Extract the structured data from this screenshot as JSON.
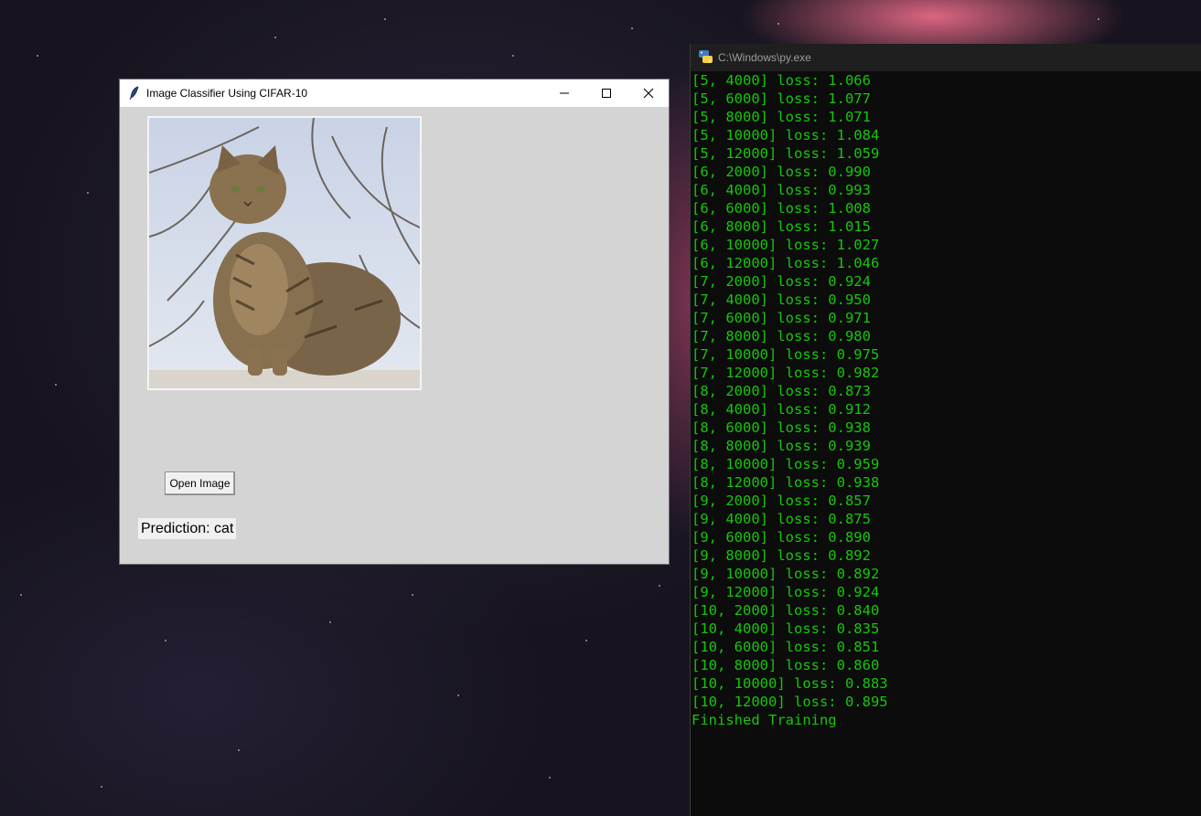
{
  "tk_window": {
    "title": "Image Classifier Using CIFAR-10",
    "open_button_label": "Open Image",
    "prediction_text": "Prediction: cat"
  },
  "console": {
    "title": "C:\\Windows\\py.exe",
    "lines": [
      "[5, 4000] loss: 1.066",
      "[5, 6000] loss: 1.077",
      "[5, 8000] loss: 1.071",
      "[5, 10000] loss: 1.084",
      "[5, 12000] loss: 1.059",
      "[6, 2000] loss: 0.990",
      "[6, 4000] loss: 0.993",
      "[6, 6000] loss: 1.008",
      "[6, 8000] loss: 1.015",
      "[6, 10000] loss: 1.027",
      "[6, 12000] loss: 1.046",
      "[7, 2000] loss: 0.924",
      "[7, 4000] loss: 0.950",
      "[7, 6000] loss: 0.971",
      "[7, 8000] loss: 0.980",
      "[7, 10000] loss: 0.975",
      "[7, 12000] loss: 0.982",
      "[8, 2000] loss: 0.873",
      "[8, 4000] loss: 0.912",
      "[8, 6000] loss: 0.938",
      "[8, 8000] loss: 0.939",
      "[8, 10000] loss: 0.959",
      "[8, 12000] loss: 0.938",
      "[9, 2000] loss: 0.857",
      "[9, 4000] loss: 0.875",
      "[9, 6000] loss: 0.890",
      "[9, 8000] loss: 0.892",
      "[9, 10000] loss: 0.892",
      "[9, 12000] loss: 0.924",
      "[10, 2000] loss: 0.840",
      "[10, 4000] loss: 0.835",
      "[10, 6000] loss: 0.851",
      "[10, 8000] loss: 0.860",
      "[10, 10000] loss: 0.883",
      "[10, 12000] loss: 0.895",
      "Finished Training"
    ]
  },
  "colors": {
    "console_text": "#16c60c",
    "console_bg": "#0c0c0c",
    "tk_bg": "#d4d4d4"
  },
  "icons": [
    "feather-icon",
    "minimize-icon",
    "maximize-icon",
    "close-icon",
    "python-icon"
  ]
}
